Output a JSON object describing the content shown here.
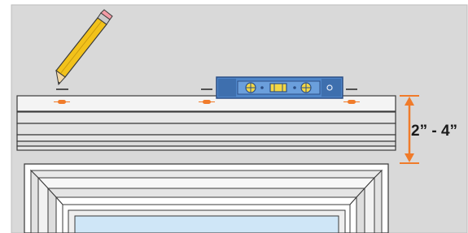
{
  "measurement": {
    "label": "2” - 4”",
    "color": "#f07b2a"
  },
  "colors": {
    "wall": "#d9d9d9",
    "board": "#f4f4f4",
    "outline": "#3a3a3a",
    "level_body": "#5a8fd0",
    "level_dark": "#2c4f86",
    "pencil_body": "#f2c21b",
    "window_glass": "#cfe6f7",
    "marks": "#f07b2a"
  },
  "icons": {
    "pencil": "pencil-icon",
    "level": "bubble-level-icon",
    "dimension_arrow": "double-arrow-icon"
  }
}
